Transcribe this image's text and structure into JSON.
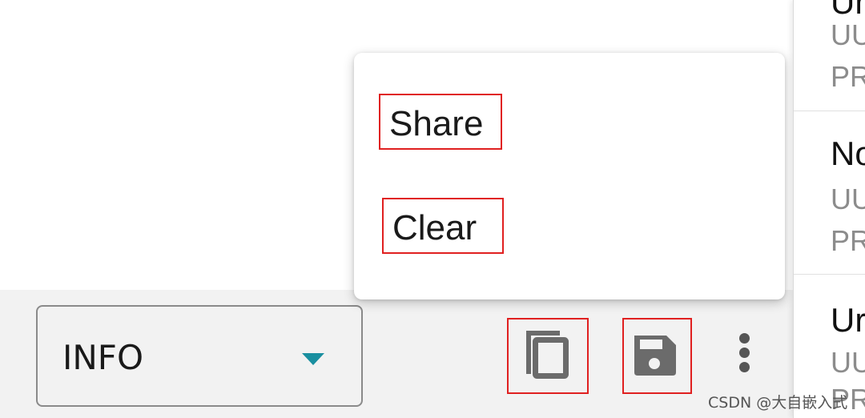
{
  "bottom_bar": {
    "log_level": "INFO"
  },
  "icons": {
    "dropdown": "caret-down-icon",
    "copy": "copy-icon",
    "save": "floppy-disk-icon",
    "more": "more-vertical-icon"
  },
  "colors": {
    "accent": "#1a8fa0",
    "highlight_box": "#e02020"
  },
  "popup_menu": {
    "items": [
      {
        "label": "Share"
      },
      {
        "label": "Clear"
      }
    ]
  },
  "device_list": {
    "entries": [
      {
        "name": "Un",
        "line1": "UU",
        "line2": "PR"
      },
      {
        "name": "No",
        "line1": "UU",
        "line2": "PR"
      },
      {
        "name": "Ur",
        "line1": "UU",
        "line2": "PR"
      }
    ]
  },
  "watermark": "CSDN @大自嵌入式"
}
